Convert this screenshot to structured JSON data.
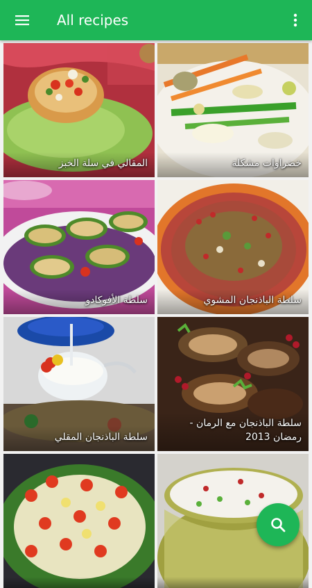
{
  "appbar": {
    "title": "All recipes",
    "menu_icon": "hamburger-menu-icon",
    "overflow_icon": "more-vert-icon",
    "color": "#1eb657"
  },
  "recipes": [
    {
      "name": "المقالي في سلة الخبز"
    },
    {
      "name": "خضراوات مشكلة"
    },
    {
      "name": "سلطة الأفوكادو"
    },
    {
      "name": "سلطة الباذنجان المشوي"
    },
    {
      "name": "سلطة الباذنجان المقلي"
    },
    {
      "name": "سلطة الباذنجان مع الرمان - رمضان 2013"
    },
    {
      "name": ""
    },
    {
      "name": ""
    }
  ],
  "fab": {
    "icon": "search-icon",
    "color": "#1eb657"
  }
}
